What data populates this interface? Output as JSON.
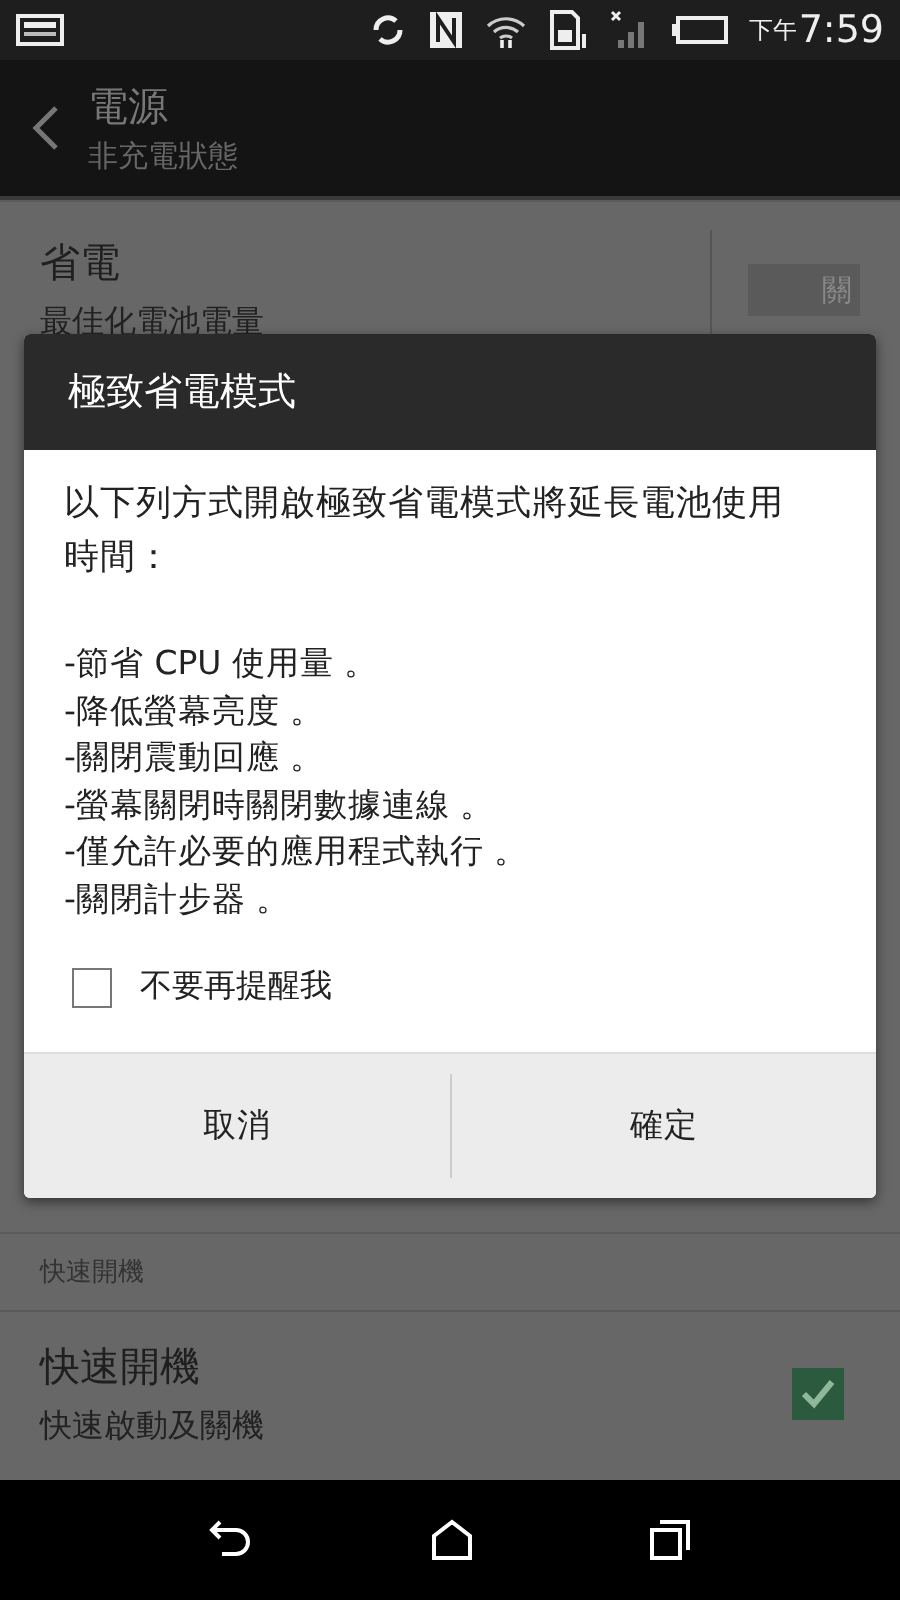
{
  "status_bar": {
    "period": "下午",
    "time": "7:59"
  },
  "app_bar": {
    "title": "電源",
    "subtitle": "非充電狀態"
  },
  "settings": [
    {
      "kind": "switch",
      "title": "省電",
      "summary": "最佳化電池電量",
      "switch_label": "關",
      "on": false
    }
  ],
  "section": {
    "header": "快速開機",
    "rows": [
      {
        "kind": "checkbox",
        "title": "快速開機",
        "summary": "快速啟動及關機",
        "checked": true
      }
    ]
  },
  "dialog": {
    "title": "極致省電模式",
    "intro": "以下列方式開啟極致省電模式將延長電池使用時間：",
    "items": [
      "-節省 CPU 使用量 。",
      "-降低螢幕亮度 。",
      "-關閉震動回應 。",
      "-螢幕關閉時關閉數據連線 。",
      "-僅允許必要的應用程式執行 。",
      "-關閉計步器 。"
    ],
    "dont_remind": {
      "label": "不要再提醒我",
      "checked": false
    },
    "buttons": [
      "取消",
      "確定"
    ]
  }
}
